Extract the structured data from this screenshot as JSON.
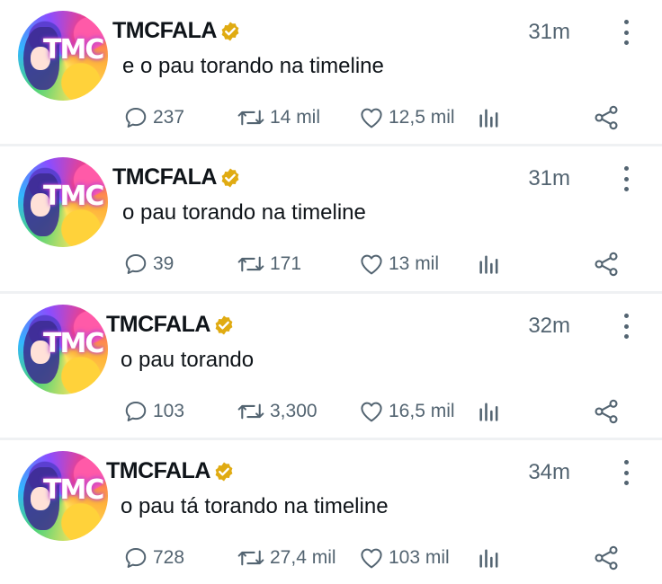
{
  "tweets": [
    {
      "author": "TMCFALA",
      "avatar_text": "TMC",
      "time": "31m",
      "text": "e o pau torando na timeline",
      "replies": "237",
      "retweets": "14 mil",
      "likes": "12,5 mil"
    },
    {
      "author": "TMCFALA",
      "avatar_text": "TMC",
      "time": "31m",
      "text": "o pau torando na timeline",
      "replies": "39",
      "retweets": "171",
      "likes": "13 mil"
    },
    {
      "author": "TMCFALA",
      "avatar_text": "TMC",
      "time": "32m",
      "text": "o pau torando",
      "replies": "103",
      "retweets": "3,300",
      "likes": "16,5 mil"
    },
    {
      "author": "TMCFALA",
      "avatar_text": "TMC",
      "time": "34m",
      "text": "o pau tá torando na timeline",
      "replies": "728",
      "retweets": "27,4 mil",
      "likes": "103 mil"
    }
  ],
  "colors": {
    "verified_badge": "#e0ab12",
    "secondary_text": "#536471",
    "primary_text": "#0f1419",
    "divider": "#eff1f3"
  },
  "icons": [
    "chat-bubble-icon",
    "retweet-icon",
    "heart-icon",
    "views-bar-chart-icon",
    "share-icon",
    "verified-badge-icon",
    "more-options-icon"
  ]
}
